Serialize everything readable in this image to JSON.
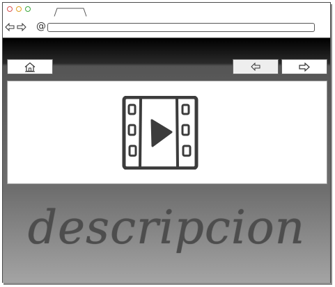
{
  "browser": {
    "address_bar": {
      "url": "",
      "at_symbol": "@"
    }
  },
  "toolbar": {
    "home_button": {
      "icon": "home-icon"
    },
    "prev_button": {
      "icon": "arrow-left-icon"
    },
    "next_button": {
      "icon": "arrow-right-icon"
    }
  },
  "media": {
    "icon": "video-film-icon"
  },
  "content": {
    "description": "descripcion"
  },
  "colors": {
    "panel": "#ffffff",
    "text": "#4d4d4d",
    "gradient_top": "#000000",
    "gradient_bottom": "#a4a4a4"
  }
}
